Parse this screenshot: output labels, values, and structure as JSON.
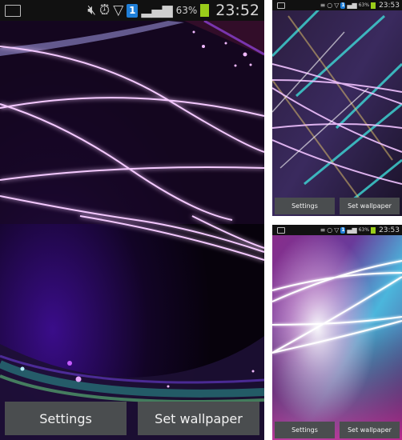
{
  "screens": [
    {
      "id": "main",
      "status_bar": {
        "left_icon": "image-icon",
        "icons": [
          "vibrate-icon",
          "alarm-icon",
          "wifi-icon",
          "sim-1-icon",
          "signal-icon"
        ],
        "sim_label": "1",
        "battery_percent": "63%",
        "battery_level": 0.63,
        "time": "23:52"
      },
      "wallpaper": "purple-neon-lines",
      "buttons": {
        "settings": "Settings",
        "set_wallpaper": "Set wallpaper"
      }
    },
    {
      "id": "preview-top",
      "status_bar": {
        "left_icon": "image-icon",
        "icons": [
          "vibrate-icon",
          "alarm-icon",
          "wifi-icon",
          "sim-1-icon",
          "signal-icon"
        ],
        "sim_label": "1",
        "battery_percent": "63%",
        "battery_level": 0.63,
        "time": "23:53"
      },
      "wallpaper": "prismatic-lines",
      "buttons": {
        "settings": "Settings",
        "set_wallpaper": "Set wallpaper"
      }
    },
    {
      "id": "preview-bottom",
      "status_bar": {
        "left_icon": "image-icon",
        "icons": [
          "vibrate-icon",
          "alarm-icon",
          "wifi-icon",
          "sim-1-icon",
          "signal-icon"
        ],
        "sim_label": "1",
        "battery_percent": "63%",
        "battery_level": 0.63,
        "time": "23:53"
      },
      "wallpaper": "pink-blue-glow-lines",
      "buttons": {
        "settings": "Settings",
        "set_wallpaper": "Set wallpaper"
      }
    }
  ],
  "colors": {
    "button_bg": "#4a4d4f",
    "status_bar_bg": "#111111",
    "battery": "#9acd1a",
    "sim_badge": "#1f7fd8",
    "neon_line": "#e59cff"
  }
}
